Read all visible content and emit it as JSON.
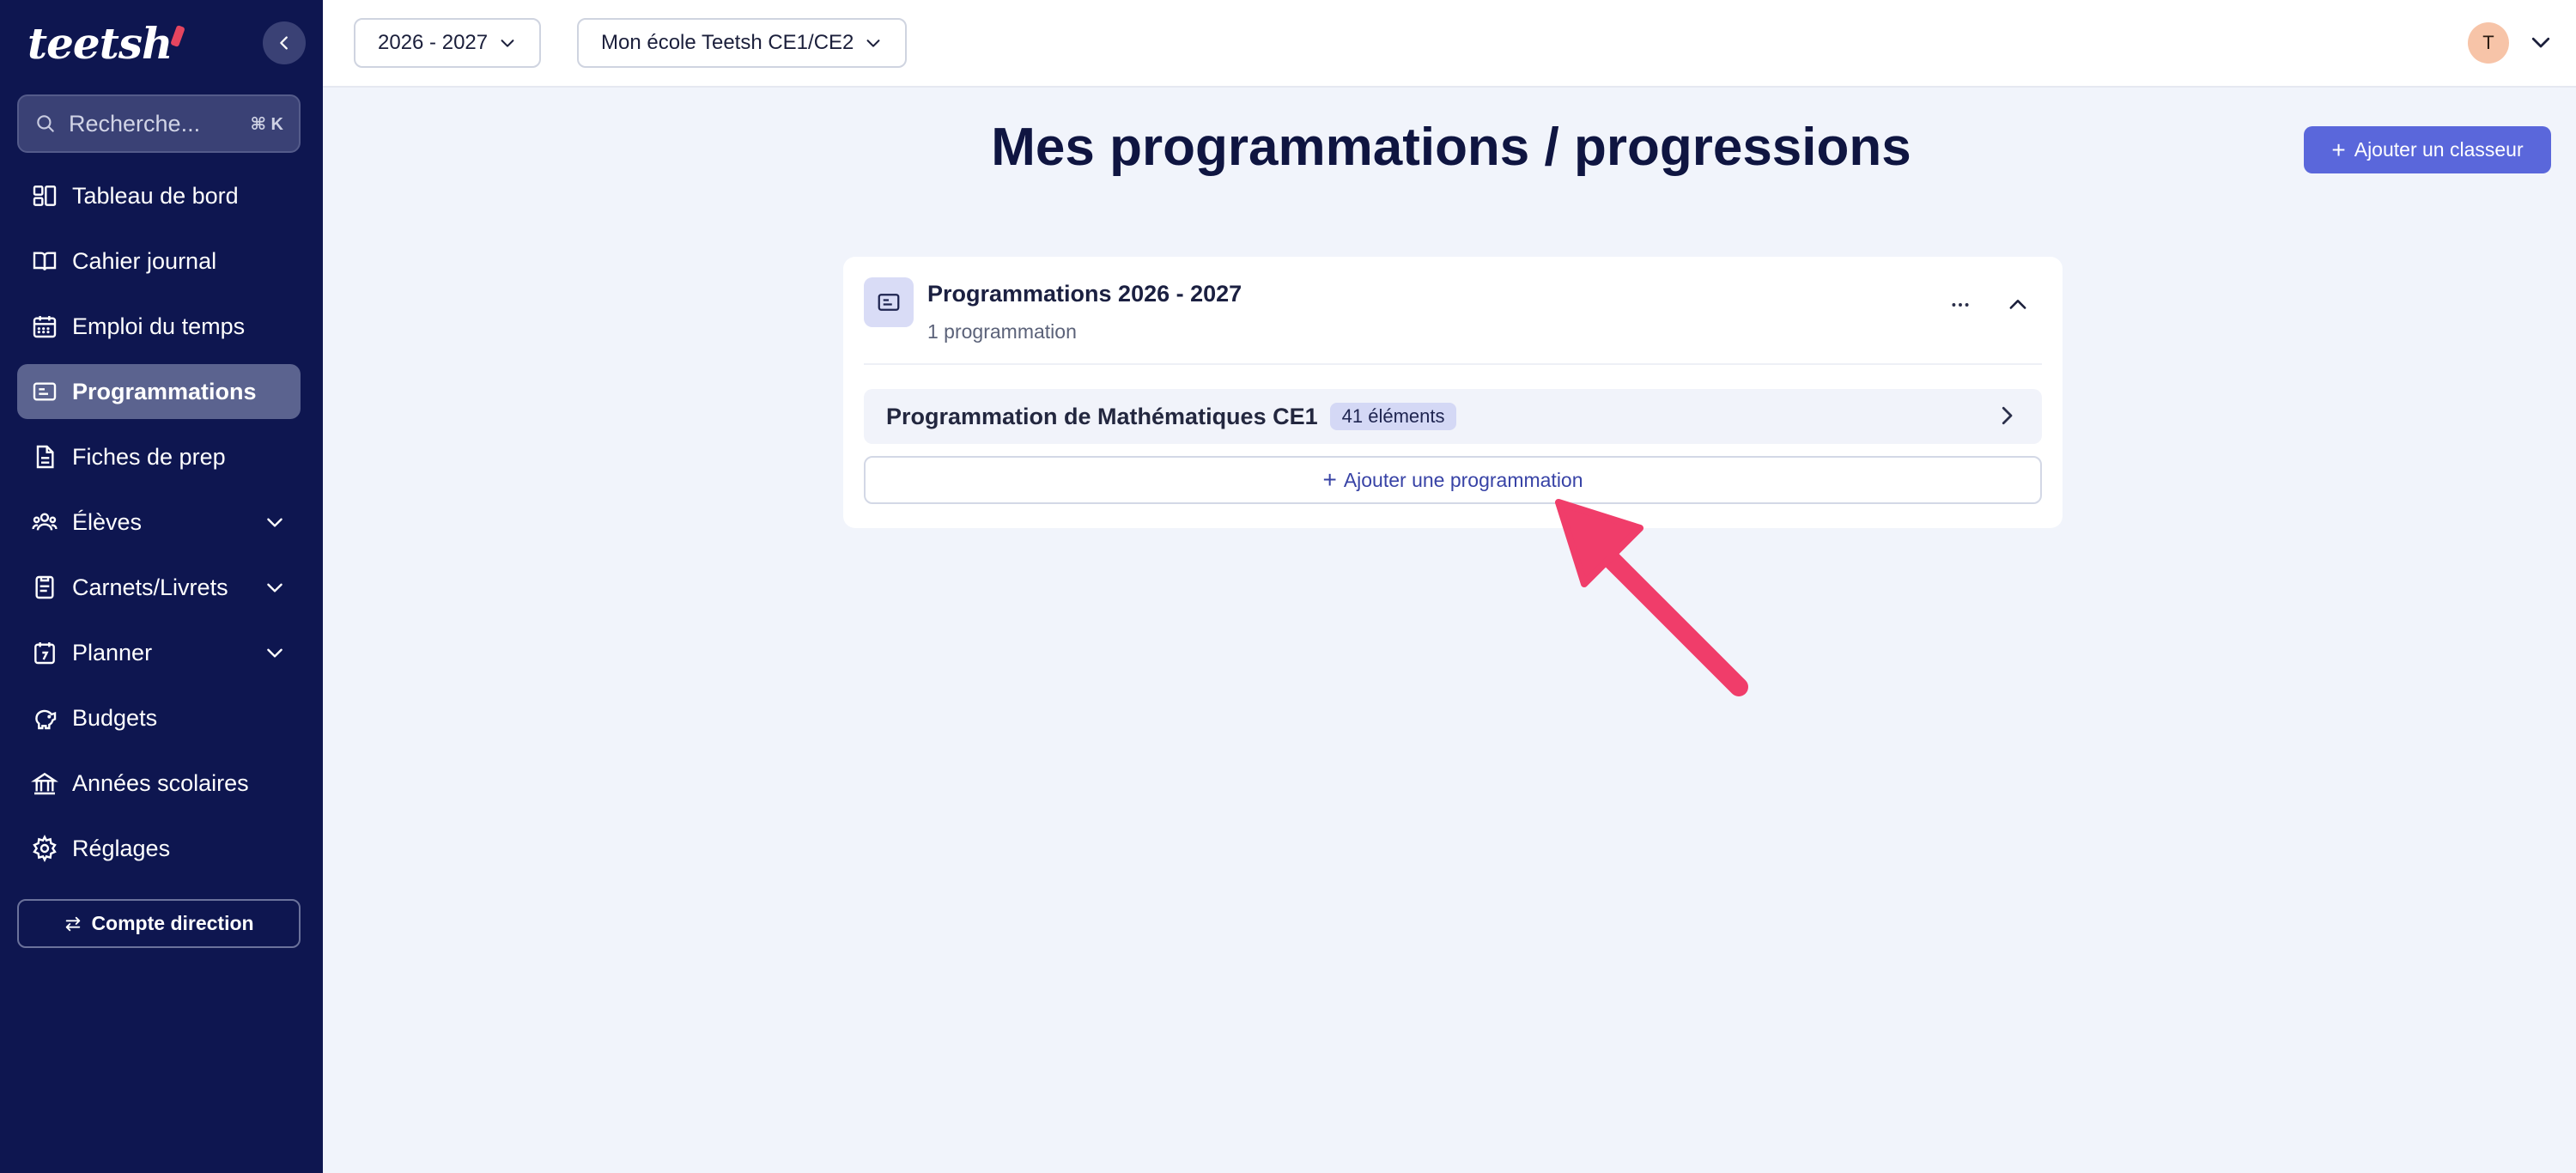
{
  "sidebar": {
    "logo": "teetsh",
    "search": {
      "placeholder": "Recherche...",
      "shortcut": "⌘ K"
    },
    "items": [
      {
        "label": "Tableau de bord",
        "icon": "dashboard-icon"
      },
      {
        "label": "Cahier journal",
        "icon": "book-open-icon"
      },
      {
        "label": "Emploi du temps",
        "icon": "calendar-icon"
      },
      {
        "label": "Programmations",
        "icon": "presentation-icon",
        "active": true
      },
      {
        "label": "Fiches de prep",
        "icon": "document-icon"
      },
      {
        "label": "Élèves",
        "icon": "users-icon",
        "expandable": true
      },
      {
        "label": "Carnets/Livrets",
        "icon": "notebook-icon",
        "expandable": true
      },
      {
        "label": "Planner",
        "icon": "planner-icon",
        "expandable": true
      },
      {
        "label": "Budgets",
        "icon": "piggy-bank-icon"
      },
      {
        "label": "Années scolaires",
        "icon": "school-building-icon"
      },
      {
        "label": "Réglages",
        "icon": "gear-icon"
      }
    ],
    "account_button": "Compte direction"
  },
  "topbar": {
    "year_select": "2026 - 2027",
    "class_select": "Mon école Teetsh CE1/CE2",
    "avatar_initial": "T"
  },
  "main": {
    "title": "Mes programmations / progressions",
    "add_binder_button": "Ajouter un classeur",
    "card": {
      "title": "Programmations 2026 - 2027",
      "subtitle": "1 programmation",
      "programs": [
        {
          "name": "Programmation de Mathématiques CE1",
          "badge": "41 éléments"
        }
      ],
      "add_program_button": "Ajouter une programmation"
    }
  },
  "colors": {
    "sidebar_bg": "#0e1650",
    "accent": "#5a67db",
    "arrow": "#f03d6a",
    "page_bg": "#f1f4fb"
  }
}
